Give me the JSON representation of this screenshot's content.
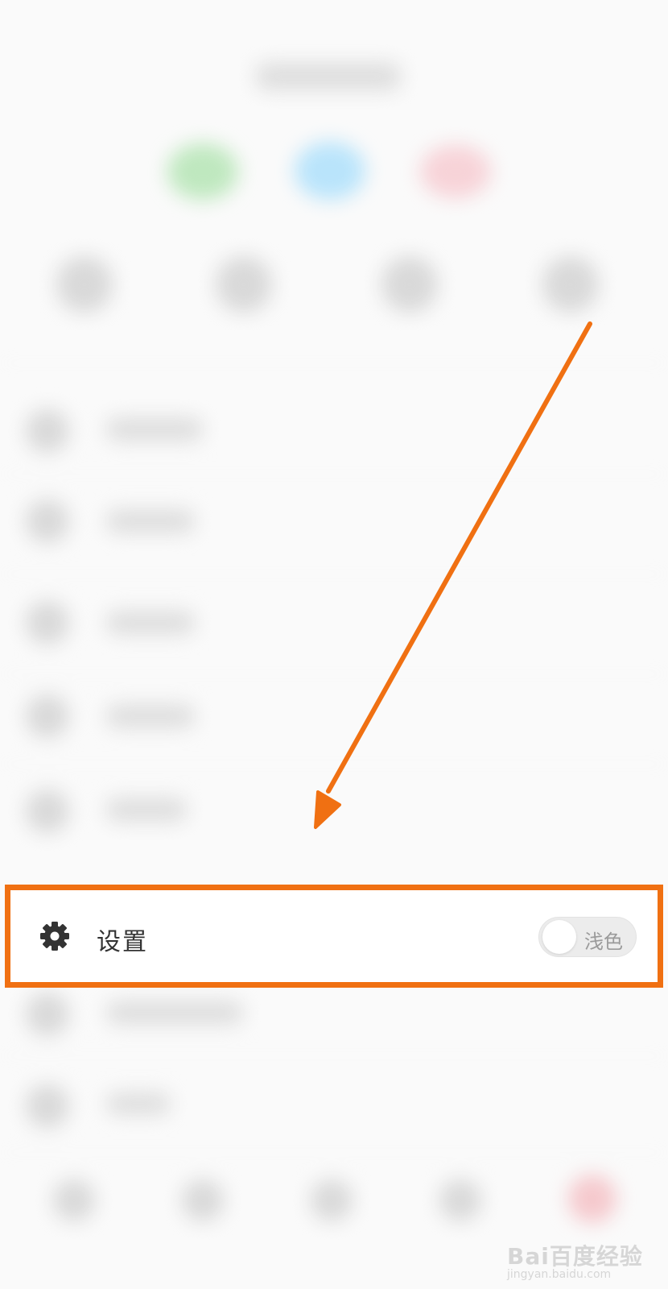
{
  "settings_item": {
    "icon": "gear-icon",
    "label": "设置",
    "theme_toggle": {
      "label": "浅色",
      "state": "off"
    }
  },
  "annotation": {
    "color": "#f07012"
  },
  "watermark": {
    "brand": "Bai百度经验",
    "url": "jingyan.baidu.com"
  }
}
